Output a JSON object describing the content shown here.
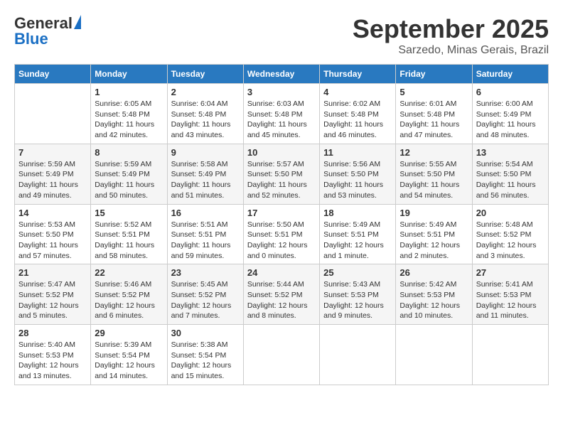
{
  "header": {
    "logo_general": "General",
    "logo_blue": "Blue",
    "month": "September 2025",
    "location": "Sarzedo, Minas Gerais, Brazil"
  },
  "columns": [
    "Sunday",
    "Monday",
    "Tuesday",
    "Wednesday",
    "Thursday",
    "Friday",
    "Saturday"
  ],
  "weeks": [
    [
      null,
      {
        "day": 1,
        "sunrise": "6:05 AM",
        "sunset": "5:48 PM",
        "daylight": "11 hours and 42 minutes."
      },
      {
        "day": 2,
        "sunrise": "6:04 AM",
        "sunset": "5:48 PM",
        "daylight": "11 hours and 43 minutes."
      },
      {
        "day": 3,
        "sunrise": "6:03 AM",
        "sunset": "5:48 PM",
        "daylight": "11 hours and 45 minutes."
      },
      {
        "day": 4,
        "sunrise": "6:02 AM",
        "sunset": "5:48 PM",
        "daylight": "11 hours and 46 minutes."
      },
      {
        "day": 5,
        "sunrise": "6:01 AM",
        "sunset": "5:48 PM",
        "daylight": "11 hours and 47 minutes."
      },
      {
        "day": 6,
        "sunrise": "6:00 AM",
        "sunset": "5:49 PM",
        "daylight": "11 hours and 48 minutes."
      }
    ],
    [
      {
        "day": 7,
        "sunrise": "5:59 AM",
        "sunset": "5:49 PM",
        "daylight": "11 hours and 49 minutes."
      },
      {
        "day": 8,
        "sunrise": "5:59 AM",
        "sunset": "5:49 PM",
        "daylight": "11 hours and 50 minutes."
      },
      {
        "day": 9,
        "sunrise": "5:58 AM",
        "sunset": "5:49 PM",
        "daylight": "11 hours and 51 minutes."
      },
      {
        "day": 10,
        "sunrise": "5:57 AM",
        "sunset": "5:50 PM",
        "daylight": "11 hours and 52 minutes."
      },
      {
        "day": 11,
        "sunrise": "5:56 AM",
        "sunset": "5:50 PM",
        "daylight": "11 hours and 53 minutes."
      },
      {
        "day": 12,
        "sunrise": "5:55 AM",
        "sunset": "5:50 PM",
        "daylight": "11 hours and 54 minutes."
      },
      {
        "day": 13,
        "sunrise": "5:54 AM",
        "sunset": "5:50 PM",
        "daylight": "11 hours and 56 minutes."
      }
    ],
    [
      {
        "day": 14,
        "sunrise": "5:53 AM",
        "sunset": "5:50 PM",
        "daylight": "11 hours and 57 minutes."
      },
      {
        "day": 15,
        "sunrise": "5:52 AM",
        "sunset": "5:51 PM",
        "daylight": "11 hours and 58 minutes."
      },
      {
        "day": 16,
        "sunrise": "5:51 AM",
        "sunset": "5:51 PM",
        "daylight": "11 hours and 59 minutes."
      },
      {
        "day": 17,
        "sunrise": "5:50 AM",
        "sunset": "5:51 PM",
        "daylight": "12 hours and 0 minutes."
      },
      {
        "day": 18,
        "sunrise": "5:49 AM",
        "sunset": "5:51 PM",
        "daylight": "12 hours and 1 minute."
      },
      {
        "day": 19,
        "sunrise": "5:49 AM",
        "sunset": "5:51 PM",
        "daylight": "12 hours and 2 minutes."
      },
      {
        "day": 20,
        "sunrise": "5:48 AM",
        "sunset": "5:52 PM",
        "daylight": "12 hours and 3 minutes."
      }
    ],
    [
      {
        "day": 21,
        "sunrise": "5:47 AM",
        "sunset": "5:52 PM",
        "daylight": "12 hours and 5 minutes."
      },
      {
        "day": 22,
        "sunrise": "5:46 AM",
        "sunset": "5:52 PM",
        "daylight": "12 hours and 6 minutes."
      },
      {
        "day": 23,
        "sunrise": "5:45 AM",
        "sunset": "5:52 PM",
        "daylight": "12 hours and 7 minutes."
      },
      {
        "day": 24,
        "sunrise": "5:44 AM",
        "sunset": "5:52 PM",
        "daylight": "12 hours and 8 minutes."
      },
      {
        "day": 25,
        "sunrise": "5:43 AM",
        "sunset": "5:53 PM",
        "daylight": "12 hours and 9 minutes."
      },
      {
        "day": 26,
        "sunrise": "5:42 AM",
        "sunset": "5:53 PM",
        "daylight": "12 hours and 10 minutes."
      },
      {
        "day": 27,
        "sunrise": "5:41 AM",
        "sunset": "5:53 PM",
        "daylight": "12 hours and 11 minutes."
      }
    ],
    [
      {
        "day": 28,
        "sunrise": "5:40 AM",
        "sunset": "5:53 PM",
        "daylight": "12 hours and 13 minutes."
      },
      {
        "day": 29,
        "sunrise": "5:39 AM",
        "sunset": "5:54 PM",
        "daylight": "12 hours and 14 minutes."
      },
      {
        "day": 30,
        "sunrise": "5:38 AM",
        "sunset": "5:54 PM",
        "daylight": "12 hours and 15 minutes."
      },
      null,
      null,
      null,
      null
    ]
  ]
}
